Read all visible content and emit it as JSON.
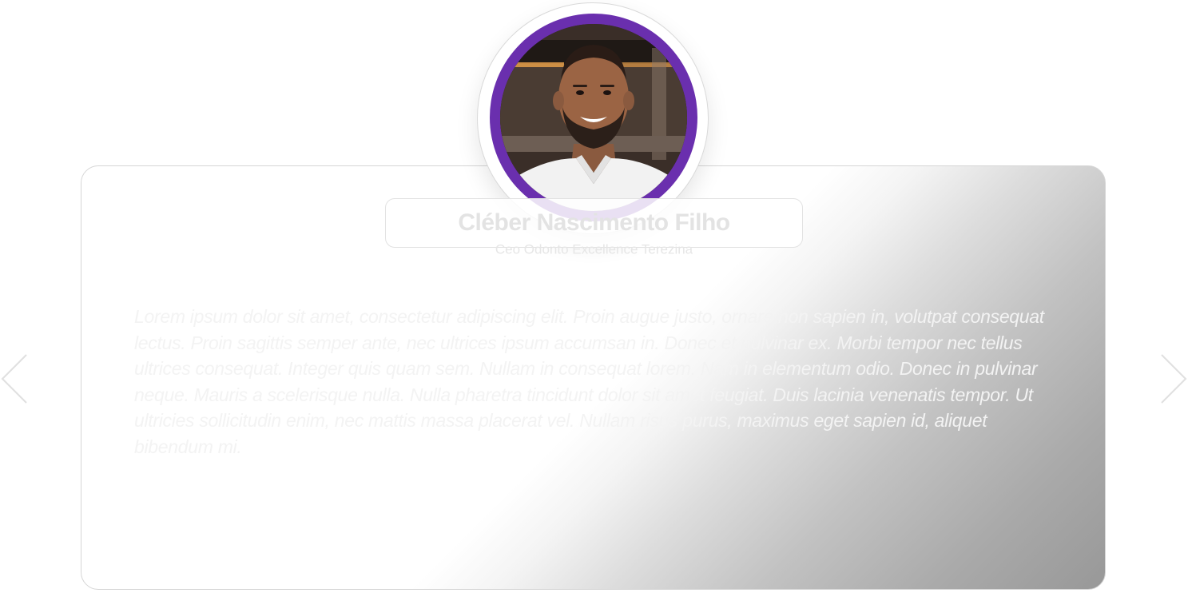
{
  "testimonial": {
    "person_name": "Cléber Nascimento Filho",
    "person_role": "Ceo Odonto Excellence Terezina",
    "quote": "Lorem ipsum dolor sit amet, consectetur adipiscing elit. Proin augue justo, ornare non sapien in, volutpat consequat lectus. Proin sagittis semper ante, nec ultrices ipsum accumsan in. Donec et pulvinar ex. Morbi tempor nec tellus ultrices consequat. Integer quis quam sem. Nullam in consequat lorem. Nam in elementum odio. Donec in pulvinar neque. Mauris a scelerisque nulla. Nulla pharetra tincidunt dolor sit amet feugiat. Duis lacinia venenatis tempor. Ut ultricies sollicitudin enim, nec mattis massa placerat vel. Nullam risus purus, maximus eget sapien id, aliquet bibendum mi."
  },
  "navigation": {
    "prev_icon": "chevron-left-icon",
    "next_icon": "chevron-right-icon"
  },
  "colors": {
    "avatar_ring": "#6a2fae",
    "text_faint": "#e3e3e3",
    "card_gradient_end": "#989898"
  }
}
